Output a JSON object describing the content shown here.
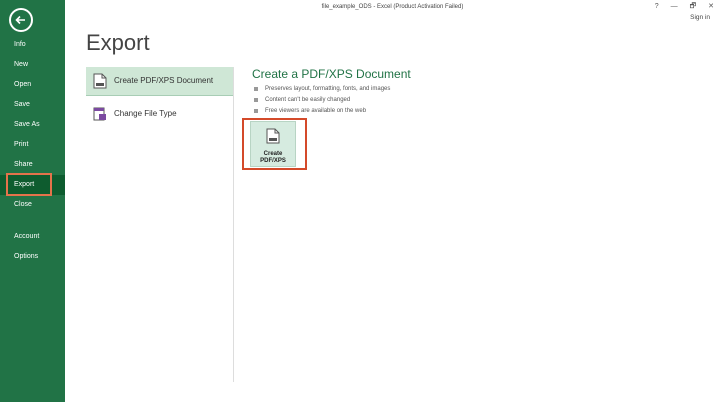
{
  "window": {
    "title": "file_example_ODS - Excel (Product Activation Failed)",
    "controls": [
      "?",
      "—",
      "🗗",
      "✕"
    ],
    "signin": "Sign in"
  },
  "sidebar": {
    "items": [
      {
        "label": "Info"
      },
      {
        "label": "New"
      },
      {
        "label": "Open"
      },
      {
        "label": "Save"
      },
      {
        "label": "Save As"
      },
      {
        "label": "Print"
      },
      {
        "label": "Share"
      },
      {
        "label": "Export"
      },
      {
        "label": "Close"
      },
      {
        "label": "Account"
      },
      {
        "label": "Options"
      }
    ]
  },
  "main": {
    "title": "Export",
    "options": [
      {
        "label": "Create PDF/XPS Document",
        "icon": "pdf-document-icon"
      },
      {
        "label": "Change File Type",
        "icon": "change-file-type-icon"
      }
    ],
    "detail": {
      "title": "Create a PDF/XPS Document",
      "bullets": [
        "Preserves layout, formatting, fonts, and images",
        "Content can't be easily changed",
        "Free viewers are available on the web"
      ],
      "button_label_line1": "Create",
      "button_label_line2": "PDF/XPS"
    }
  },
  "colors": {
    "brand_green": "#217346",
    "selected_green": "#cfe7d6",
    "highlight_red": "#d44a2a"
  }
}
